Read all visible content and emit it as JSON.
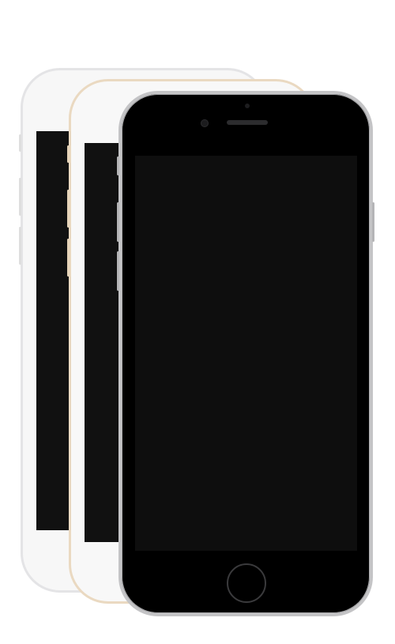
{
  "devices": [
    {
      "model": "iphone",
      "finish": "silver",
      "bezel_color": "#f7f7f7",
      "trim_color": "#e4e4e6",
      "screen_color": "#111111"
    },
    {
      "model": "iphone",
      "finish": "gold",
      "bezel_color": "#f8f8f8",
      "trim_color": "#ead9c1",
      "screen_color": "#111111"
    },
    {
      "model": "iphone",
      "finish": "space-gray",
      "bezel_color": "#000000",
      "trim_color": "#c4c4c6",
      "screen_color": "#0e0e0e"
    }
  ],
  "icons": {
    "home_button": "home-button-icon",
    "camera": "front-camera-icon",
    "speaker": "earpiece-speaker-icon"
  }
}
